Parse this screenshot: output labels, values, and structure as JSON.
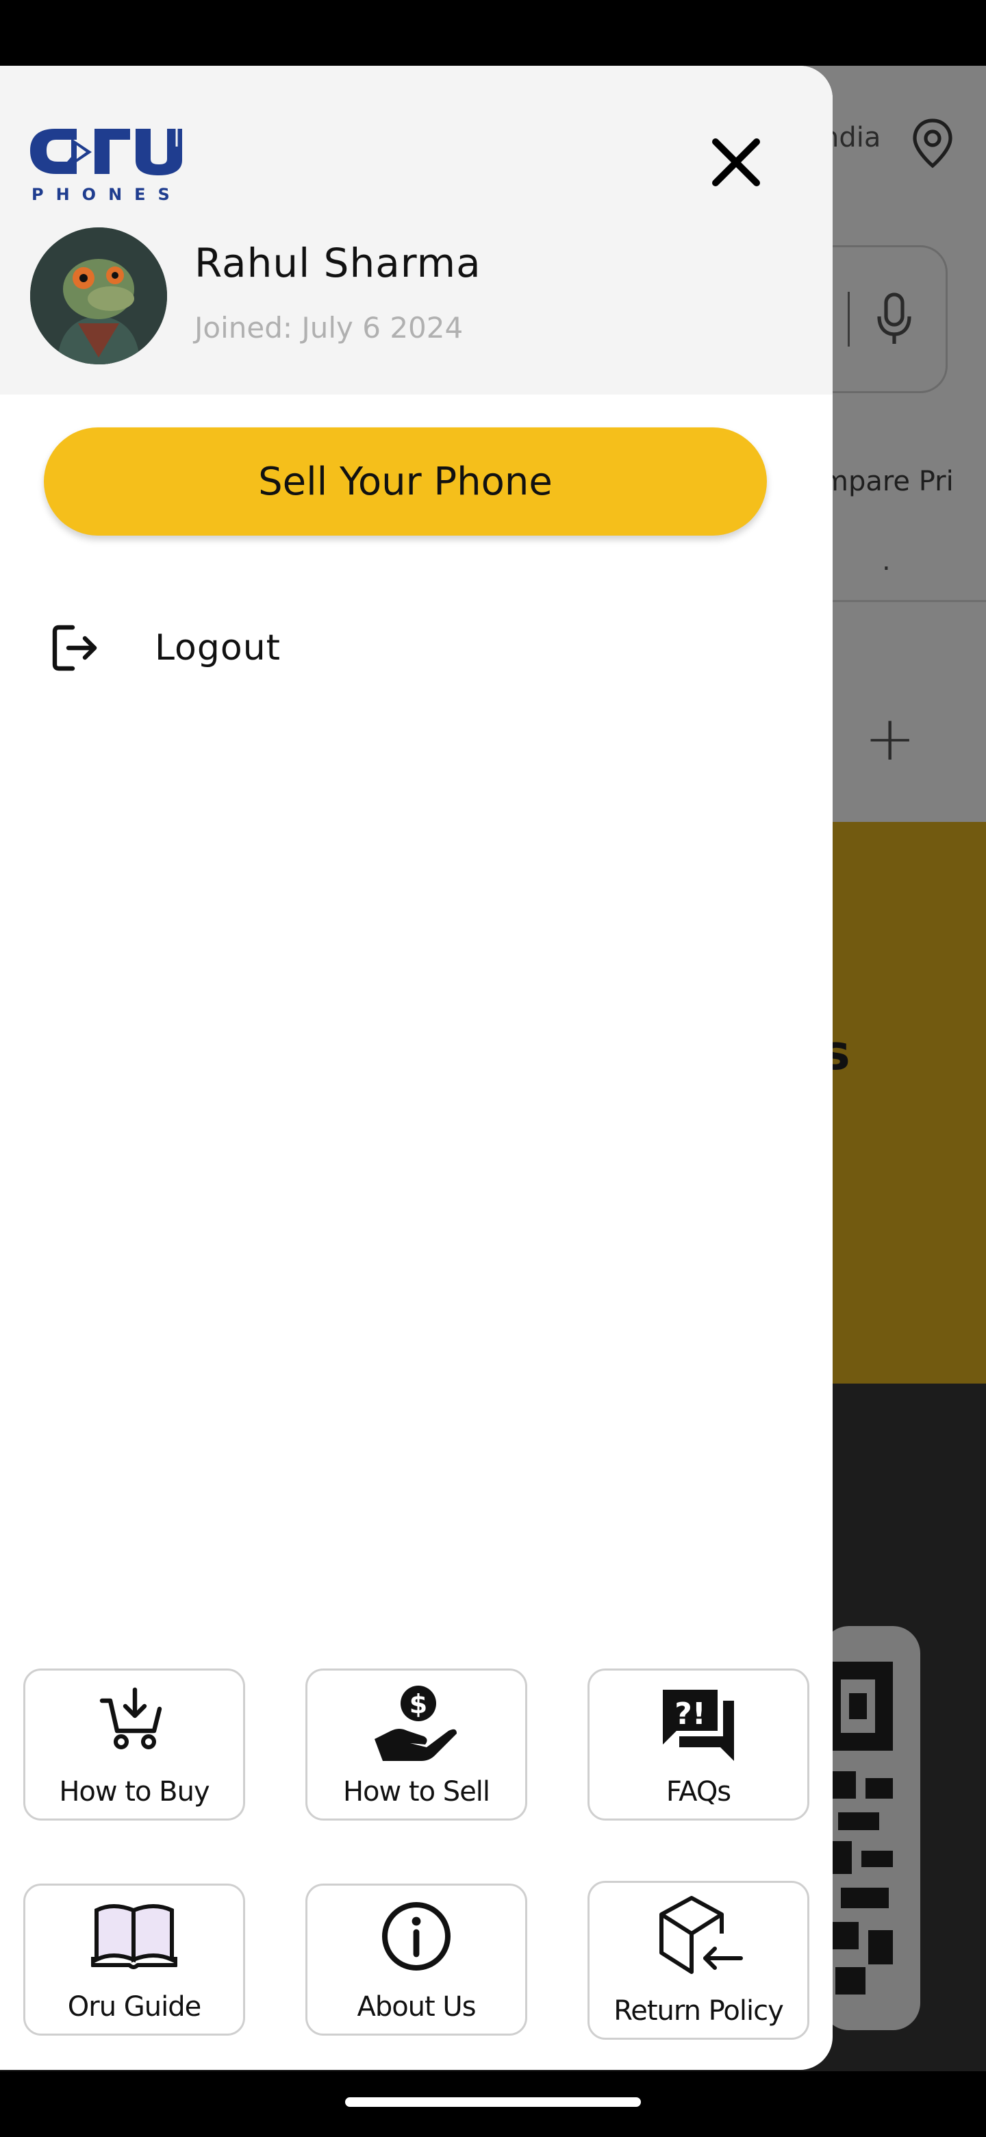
{
  "background": {
    "location_text": "ndia",
    "tab_text": "mpare Pri",
    "dot": ".",
    "plus": "+",
    "banner_text": "s"
  },
  "drawer": {
    "logo": {
      "wordmark": "oru",
      "subtitle": "PHONES"
    },
    "close_icon": "close-icon",
    "user": {
      "name": "Rahul Sharma",
      "joined": "Joined: July 6 2024"
    },
    "sell_button_label": "Sell Your Phone",
    "logout_label": "Logout",
    "tiles": [
      {
        "label": "How to Buy",
        "icon": "cart-icon"
      },
      {
        "label": "How to Sell",
        "icon": "hand-dollar-icon"
      },
      {
        "label": "FAQs",
        "icon": "faq-icon"
      },
      {
        "label": "Oru Guide",
        "icon": "book-icon"
      },
      {
        "label": "About Us",
        "icon": "info-icon"
      },
      {
        "label": "Return Policy",
        "icon": "return-box-icon"
      }
    ]
  },
  "colors": {
    "accent": "#f5bf1b",
    "logo_blue": "#1f3d8f"
  }
}
